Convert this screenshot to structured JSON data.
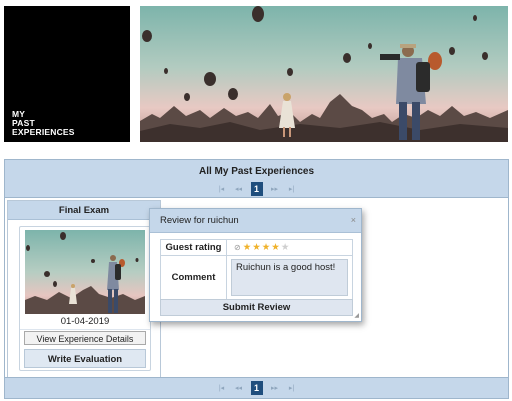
{
  "header": {
    "logo_text": "MY\nPAST\nEXPERIENCES"
  },
  "panel": {
    "title": "All My Past Experiences",
    "pager": {
      "first": "|◂",
      "prev": "◂◂",
      "current": "1",
      "next": "▸▸",
      "last": "▸|"
    }
  },
  "card": {
    "title": "Final Exam",
    "date": "01-04-2019",
    "details_button": "View Experience Details",
    "evaluation_button": "Write Evaluation"
  },
  "modal": {
    "title": "Review for ruichun",
    "close": "×",
    "rating_label": "Guest rating",
    "rating": {
      "value": 4,
      "max": 5
    },
    "comment_label": "Comment",
    "comment_value": "Ruichun is a good host!",
    "submit_label": "Submit Review"
  },
  "colors": {
    "header_blue": "#c5d7ea",
    "pager_current": "#1f4e7d",
    "star_on": "#f0b22a",
    "star_off": "#cfcfcf"
  },
  "icons": {
    "close": "close-icon",
    "clear_rating": "cancel-rating-icon",
    "resize": "resize-grip-icon",
    "pager_first": "first-page-icon",
    "pager_prev": "previous-page-icon",
    "pager_next": "next-page-icon",
    "pager_last": "last-page-icon"
  }
}
